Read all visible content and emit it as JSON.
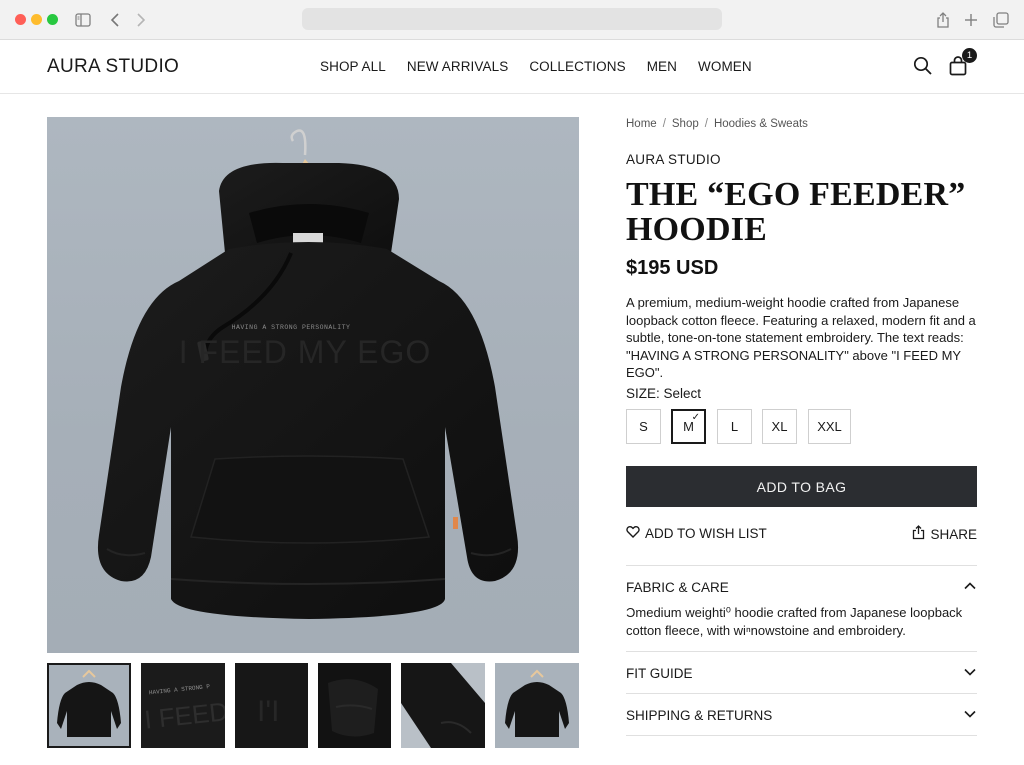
{
  "browser": {
    "icons": [
      "sidebar-icon",
      "back-icon",
      "forward-icon",
      "share-icon",
      "new-tab-icon",
      "tabs-icon"
    ]
  },
  "header": {
    "brand": "AURA STUDIO",
    "nav": [
      "SHOP ALL",
      "NEW ARRIVALS",
      "COLLECTIONS",
      "MEN",
      "WOMEN"
    ],
    "cart_count": "1",
    "icons": [
      "search-icon",
      "bag-icon"
    ]
  },
  "gallery": {
    "image_text_small": "HAVING A STRONG PERSONALITY",
    "image_text_large": "I FEED MY EGO",
    "thumbnails": [
      "front",
      "embroidery-closeup",
      "fabric-detail",
      "cuff-detail",
      "sleeve-detail",
      "back"
    ],
    "active_thumbnail": 0
  },
  "breadcrumb": [
    "Home",
    "Shop",
    "Hoodies & Sweats"
  ],
  "product": {
    "brand": "AURA STUDIO",
    "title": "THE “EGO FEEDER” HOODIE",
    "price": "$195 USD",
    "description": "A premium, medium-weight hoodie crafted from Japanese loopback cotton fleece. Featuring a relaxed, modern fit and a subtle, tone-on-tone statement embroidery. The text reads: \"HAVING A STRONG PERSONALITY\" above \"I FEED MY EGO\".",
    "size_label": "SIZE: Select",
    "sizes": [
      "S",
      "M",
      "L",
      "XL",
      "XXL"
    ],
    "selected_size": "M",
    "add_to_bag": "ADD TO BAG",
    "wish_list": "ADD TO WISH LIST",
    "share": "SHARE"
  },
  "accordion": [
    {
      "title": "FABRIC & CARE",
      "expanded": true,
      "body": "Ɔmedium weighti⁰ hoodie crafted from Japanese loopback cotton fleece, with wiⁿnowstoine and embroidery."
    },
    {
      "title": "FIT GUIDE",
      "expanded": false
    },
    {
      "title": "SHIPPING & RETURNS",
      "expanded": false
    }
  ],
  "colors": {
    "button_dark": "#2b2d31",
    "photo_bg": "#a9b2bb",
    "hoodie": "#141414"
  }
}
